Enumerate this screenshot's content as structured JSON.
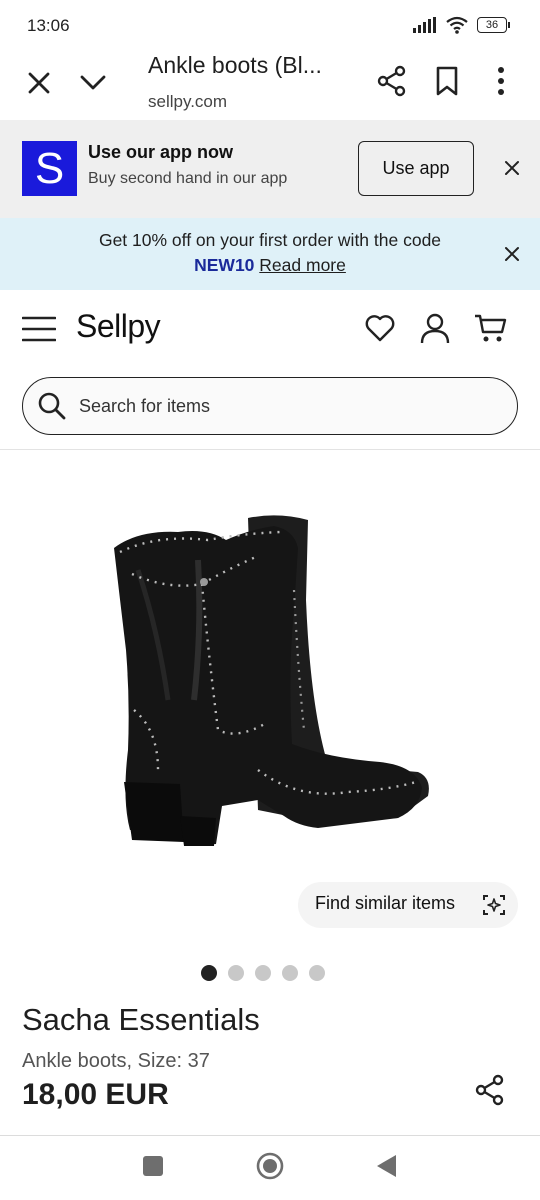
{
  "status": {
    "time": "13:06",
    "battery": "36"
  },
  "browser": {
    "title": "Ankle boots (Bl...",
    "url": "sellpy.com"
  },
  "app_banner": {
    "title": "Use our app now",
    "subtitle": "Buy second hand in our app",
    "button": "Use app",
    "logo_letter": "S"
  },
  "promo": {
    "text": "Get 10% off on your first order with the code",
    "code": "NEW10",
    "link": "Read more"
  },
  "header": {
    "logo": "Sellpy"
  },
  "search": {
    "placeholder": "Search for items"
  },
  "product": {
    "similar_label": "Find similar items",
    "image_count": 5,
    "active_image": 1,
    "brand": "Sacha Essentials",
    "subtitle": "Ankle boots, Size: 37",
    "price": "18,00 EUR"
  },
  "colors": {
    "brand_blue": "#1a1adb",
    "promo_bg": "#dff1f8",
    "banner_bg": "#efefef",
    "promo_code": "#1a2a9a"
  },
  "icons": [
    "close-icon",
    "chevron-down-icon",
    "share-icon",
    "bookmark-icon",
    "more-icon",
    "menu-icon",
    "heart-icon",
    "user-icon",
    "cart-icon",
    "search-icon",
    "visual-search-icon"
  ]
}
